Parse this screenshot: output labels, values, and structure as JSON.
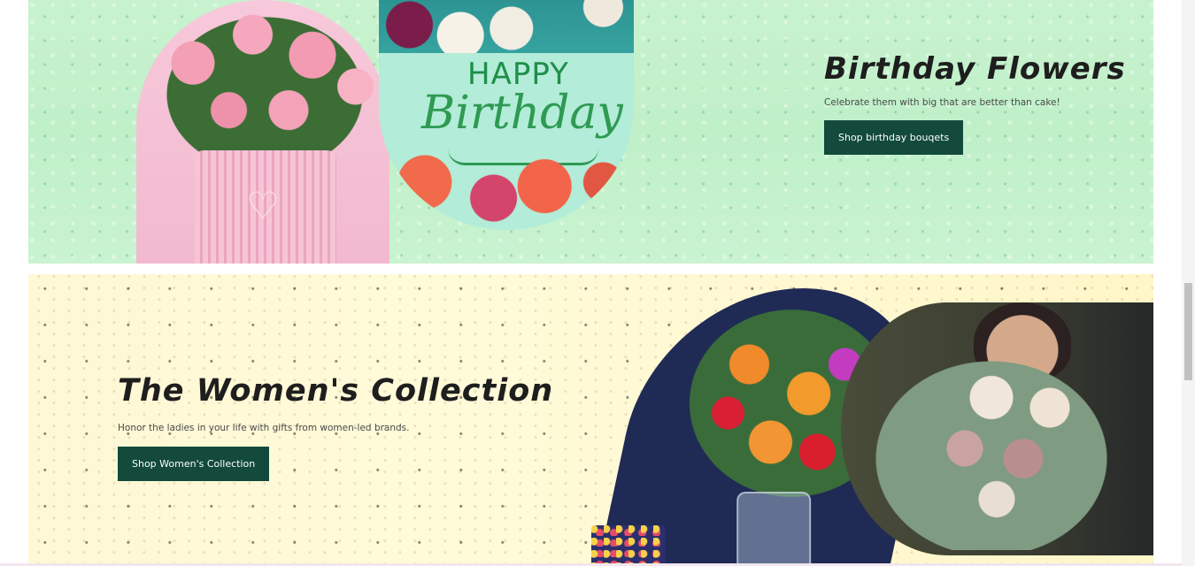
{
  "banners": {
    "birthday": {
      "title": "Birthday Flowers",
      "description": "Celebrate them with big that are better than cake!",
      "cta_label": "Shop birthday bouqets",
      "card_text_line1": "HAPPY",
      "card_text_line2": "Birthday",
      "pot_icon": "heart-icon",
      "colors": {
        "background": "#c8f2cf",
        "button": "#134a3b"
      }
    },
    "women": {
      "title": "The Women's Collection",
      "description": "Honor the ladies in your life with gifts from women-led brands.",
      "cta_label": "Shop Women's Collection",
      "colors": {
        "background": "#fff8d6",
        "button": "#134a3b"
      }
    }
  }
}
